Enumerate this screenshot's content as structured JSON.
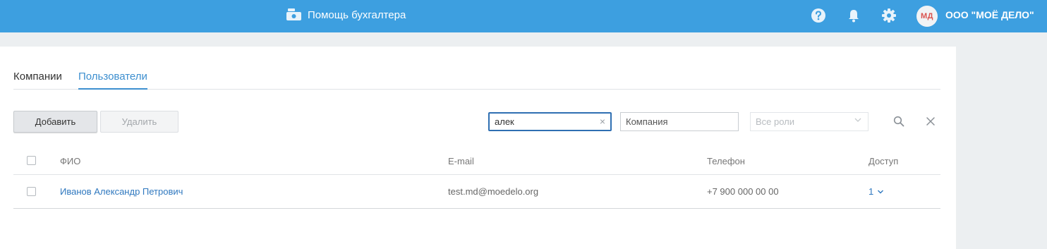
{
  "header": {
    "help_label": "Помощь бухгалтера",
    "avatar_initials": "МД",
    "company_name": "ООО \"МОЁ ДЕЛО\"",
    "icons": [
      "question-icon",
      "bell-icon",
      "gear-icon"
    ],
    "color": "#3d9fe0"
  },
  "tabs": [
    {
      "label": "Компании",
      "active": false
    },
    {
      "label": "Пользователи",
      "active": true
    }
  ],
  "toolbar": {
    "add_label": "Добавить",
    "delete_label": "Удалить",
    "search_value": "алек",
    "company_placeholder": "Компания",
    "roles_placeholder": "Все роли"
  },
  "table": {
    "columns": [
      "ФИО",
      "E-mail",
      "Телефон",
      "Доступ"
    ],
    "rows": [
      {
        "name": "Иванов Александр Петрович",
        "email": "test.md@moedelo.org",
        "phone": "+7 900 000 00 00",
        "access": "1"
      }
    ]
  },
  "colors": {
    "accent": "#3d9fe0",
    "link": "#2f78bf",
    "avatar_text": "#d9534f"
  }
}
